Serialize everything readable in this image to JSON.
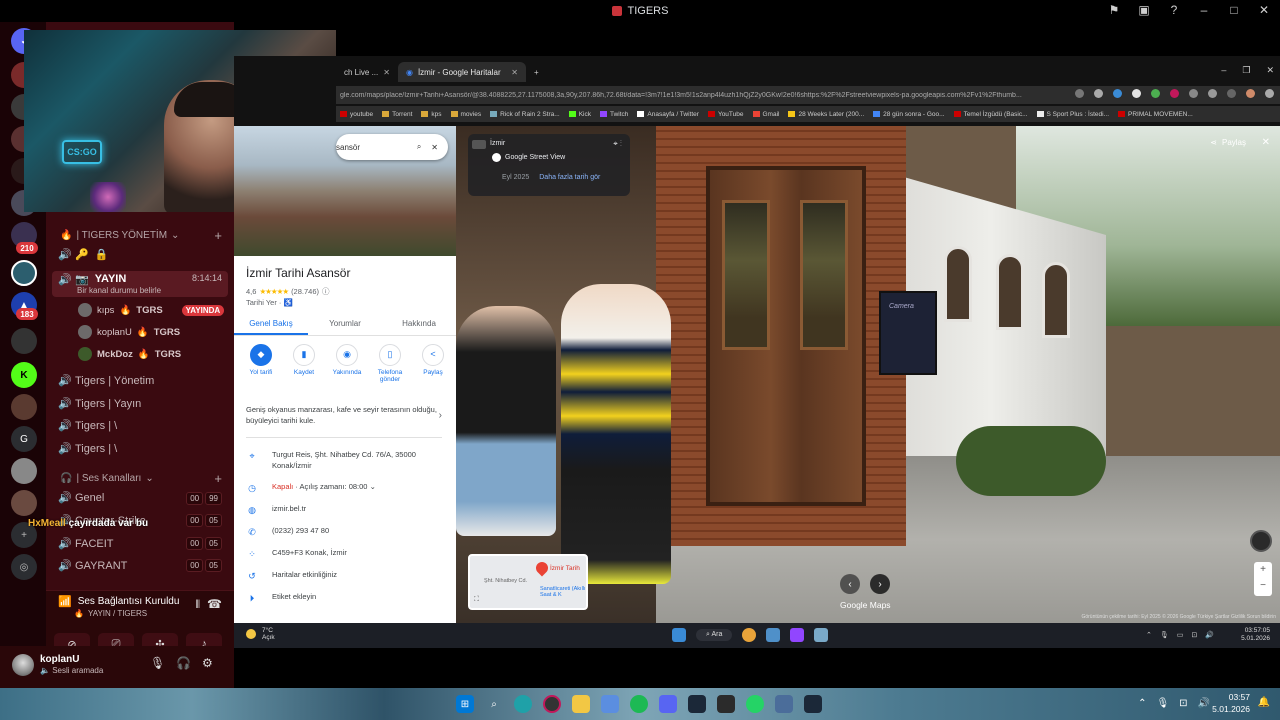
{
  "window": {
    "title": "TIGERS"
  },
  "server_rail": {
    "badges": [
      "210",
      "183"
    ],
    "letters": [
      "G"
    ]
  },
  "channels": {
    "category_admin": "| TIGERS YÖNETİM",
    "stream_channel": {
      "name": "YAYIN",
      "timer": "8:14:14",
      "status_prompt": "Bir kanal durumu belirle"
    },
    "members": [
      {
        "name": "kıps",
        "tag": "TGRS",
        "live": "YAYINDA"
      },
      {
        "name": "koplanU",
        "tag": "TGRS"
      },
      {
        "name": "MckDoz",
        "tag": "TGRS"
      }
    ],
    "text_channels": [
      "Tigers | Yönetim",
      "Tigers | Yayın",
      "Tigers | \\",
      "Tigers | \\"
    ],
    "category_voice": "| Ses Kanalları",
    "voice_channels": [
      {
        "name": "Genel",
        "counts": [
          "00",
          "99"
        ]
      },
      {
        "name": "Counter-Strike",
        "counts": [
          "00",
          "05"
        ]
      },
      {
        "name": "FACEIT",
        "counts": [
          "00",
          "05"
        ]
      },
      {
        "name": "GAYRANT",
        "counts": [
          "00",
          "05"
        ]
      }
    ]
  },
  "overlay_user": {
    "name": "HxMeall",
    "message": "çayırdada var bu"
  },
  "voice_connection": {
    "status": "Ses Bağlantısı Kuruldu",
    "channel": "YAYIN / TIGERS"
  },
  "user_panel": {
    "name": "koplanU",
    "status": "Sesli aramada"
  },
  "webcam": {
    "logo": "CS:GO"
  },
  "browser": {
    "tabs": [
      {
        "label": "ch Live ..."
      },
      {
        "label": "İzmir - Google Haritalar"
      }
    ],
    "url": "gle.com/maps/place/İzmir+Tarihi+Asansör/@38.4088225,27.1175008,3a,90y,207.86h,72.68t/data=!3m7!1e1!3m5!1s2anp4l4uzh1hQjZ2y0GKw!2e0!6shttps:%2F%2Fstreetviewpixels-pa.googleapis.com%2Fv1%2Fthumb...",
    "bookmarks": [
      "youtube",
      "Torrent",
      "kps",
      "movies",
      "Rick of Rain 2 Stra...",
      "Kick",
      "Twitch",
      "Anasayfa / Twitter",
      "YouTube",
      "Gmail",
      "28 Weeks Later (200...",
      "28 gün sonra - Goo...",
      "Temel İzgüdü (Basic...",
      "S Sport Plus : İstedi...",
      "PRIMAL MOVEMEN..."
    ]
  },
  "maps": {
    "search_query": "sansör",
    "place_title": "İzmir Tarihi Asansör",
    "rating": "4,6",
    "stars": "★★★★★",
    "review_count": "(28.746)",
    "place_type": "Tarihi Yer · ♿",
    "tabs": [
      "Genel Bakış",
      "Yorumlar",
      "Hakkında"
    ],
    "actions": [
      {
        "icon": "◆",
        "label": "Yol tarifi"
      },
      {
        "icon": "▮",
        "label": "Kaydet"
      },
      {
        "icon": "◉",
        "label": "Yakınında"
      },
      {
        "icon": "▯",
        "label": "Telefona gönder"
      },
      {
        "icon": "<",
        "label": "Paylaş"
      }
    ],
    "description": "Geniş okyanus manzarası, kafe ve seyir terasının olduğu, büyüleyici tarihi kule.",
    "address": "Turgut Reis, Şht. Nihatbey Cd. 76/A, 35000 Konak/İzmir",
    "hours_status": "Kapalı",
    "hours_detail": " · Açılış zamanı: 08:00",
    "website": "izmir.bel.tr",
    "phone": "(0232) 293 47 80",
    "plus_code": "C459+F3 Konak, İzmir",
    "activities": "Haritalar etkinliğiniz",
    "label_add": "Etiket ekleyin"
  },
  "street_view": {
    "place": "İzmir",
    "provider": "Google Street View",
    "date": "Eyl 2025",
    "more_dates": "Daha fazla tarih gör",
    "share": "Paylaş",
    "minimap_label": "İzmir Tarih",
    "minimap_sub": "Sanatlicareti (Akıllı Saat & K",
    "minimap_street": "Şht. Nihatbey Cd.",
    "logo": "Google Maps",
    "footer": "Görüntünün çekilme tarihi: Eyl 2025   © 2026 Google   Türkiye   Şartlar   Gizlilik   Sorun bildirin",
    "sign_text": "Camera"
  },
  "remote_taskbar": {
    "weather_temp": "7°C",
    "weather_desc": "Açık",
    "search": "Ara",
    "time": "03:57:05",
    "date": "5.01.2026"
  },
  "host_taskbar": {
    "time": "03:57",
    "date": "5.01.2026"
  }
}
